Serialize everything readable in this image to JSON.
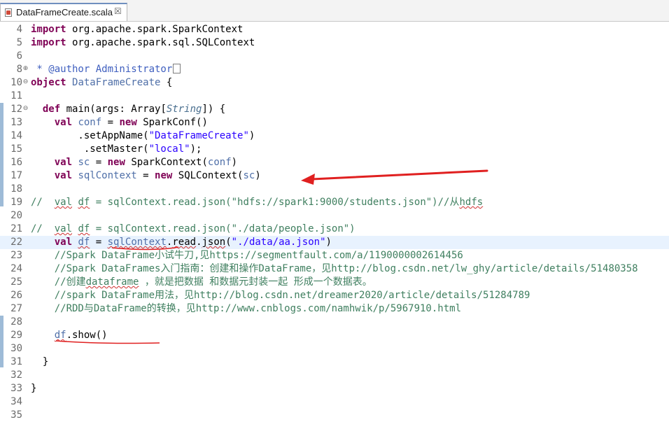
{
  "tab": {
    "title": "DataFrameCreate.scala",
    "close_glyph": "☒"
  },
  "lines": [
    {
      "n": "4",
      "fold": "",
      "parts": [
        [
          "kw",
          "import"
        ],
        [
          "t",
          " org.apache.spark.SparkContext"
        ]
      ]
    },
    {
      "n": "5",
      "fold": "",
      "parts": [
        [
          "kw",
          "import"
        ],
        [
          "t",
          " org.apache.spark.sql.SQLContext"
        ]
      ]
    },
    {
      "n": "6",
      "fold": "",
      "parts": []
    },
    {
      "n": "8",
      "fold": "+",
      "parts": [
        [
          "doc",
          " * @author Administrator"
        ],
        [
          "box",
          ""
        ]
      ]
    },
    {
      "n": "10",
      "fold": "-",
      "parts": [
        [
          "kw",
          "object"
        ],
        [
          "t",
          " "
        ],
        [
          "var",
          "DataFrameCreate"
        ],
        [
          "t",
          " {"
        ]
      ]
    },
    {
      "n": "11",
      "fold": "",
      "parts": []
    },
    {
      "n": "12",
      "fold": "-",
      "parts": [
        [
          "t",
          "  "
        ],
        [
          "kw",
          "def"
        ],
        [
          "t",
          " main(args: Array["
        ],
        [
          "ty",
          "String"
        ],
        [
          "t",
          "]) {"
        ]
      ]
    },
    {
      "n": "13",
      "fold": "",
      "parts": [
        [
          "t",
          "    "
        ],
        [
          "kw",
          "val"
        ],
        [
          "t",
          " "
        ],
        [
          "var",
          "conf"
        ],
        [
          "t",
          " = "
        ],
        [
          "kw",
          "new"
        ],
        [
          "t",
          " SparkConf()"
        ]
      ]
    },
    {
      "n": "14",
      "fold": "",
      "parts": [
        [
          "t",
          "        .setAppName("
        ],
        [
          "str",
          "\"DataFrameCreate\""
        ],
        [
          "t",
          ")"
        ]
      ]
    },
    {
      "n": "15",
      "fold": "",
      "parts": [
        [
          "t",
          "         .setMaster("
        ],
        [
          "str",
          "\"local\""
        ],
        [
          "t",
          ");"
        ]
      ]
    },
    {
      "n": "16",
      "fold": "",
      "parts": [
        [
          "t",
          "    "
        ],
        [
          "kw",
          "val"
        ],
        [
          "t",
          " "
        ],
        [
          "var",
          "sc"
        ],
        [
          "t",
          " = "
        ],
        [
          "kw",
          "new"
        ],
        [
          "t",
          " SparkContext("
        ],
        [
          "var",
          "conf"
        ],
        [
          "t",
          ")"
        ]
      ]
    },
    {
      "n": "17",
      "fold": "",
      "parts": [
        [
          "t",
          "    "
        ],
        [
          "kw",
          "val"
        ],
        [
          "t",
          " "
        ],
        [
          "var",
          "sqlContext"
        ],
        [
          "t",
          " = "
        ],
        [
          "kw",
          "new"
        ],
        [
          "t",
          " SQLContext("
        ],
        [
          "var",
          "sc"
        ],
        [
          "t",
          ")"
        ]
      ]
    },
    {
      "n": "18",
      "fold": "",
      "parts": []
    },
    {
      "n": "19",
      "fold": "",
      "parts": [
        [
          "cm",
          "//  "
        ],
        [
          "cmsq",
          "val"
        ],
        [
          "cm",
          " "
        ],
        [
          "cmsq",
          "df"
        ],
        [
          "cm",
          " = sqlContext.read.json(\"hdfs://spark1:9000/students.json\")//从"
        ],
        [
          "cmsq",
          "hdfs"
        ]
      ]
    },
    {
      "n": "20",
      "fold": "",
      "parts": []
    },
    {
      "n": "21",
      "fold": "",
      "parts": [
        [
          "cm",
          "//  "
        ],
        [
          "cmsq",
          "val"
        ],
        [
          "cm",
          " "
        ],
        [
          "cmsq",
          "df"
        ],
        [
          "cm",
          " = sqlContext.read.json(\"./data/people.json\")"
        ]
      ]
    },
    {
      "n": "22",
      "fold": "",
      "current": true,
      "parts": [
        [
          "t",
          "    "
        ],
        [
          "kw",
          "val"
        ],
        [
          "t",
          " "
        ],
        [
          "varsq",
          "df"
        ],
        [
          "t",
          " = "
        ],
        [
          "varsq",
          "sqlContext"
        ],
        [
          "t",
          "."
        ],
        [
          "sqt",
          "read"
        ],
        [
          "t",
          "."
        ],
        [
          "sqt",
          "json"
        ],
        [
          "t",
          "("
        ],
        [
          "str",
          "\"./data/aa.json\""
        ],
        [
          "t",
          ")"
        ]
      ]
    },
    {
      "n": "23",
      "fold": "",
      "parts": [
        [
          "cm",
          "    //Spark DataFrame小试牛刀,见https://segmentfault.com/a/1190000002614456"
        ]
      ]
    },
    {
      "n": "24",
      "fold": "",
      "parts": [
        [
          "cm",
          "    //Spark DataFrames入门指南：创建和操作DataFrame，见http://blog.csdn.net/lw_ghy/article/details/51480358"
        ]
      ]
    },
    {
      "n": "25",
      "fold": "",
      "parts": [
        [
          "cm",
          "    //创建"
        ],
        [
          "cmsq",
          "dataframe"
        ],
        [
          "cm",
          " ，就是把数据 和数据元封装一起 形成一个数据表。"
        ]
      ]
    },
    {
      "n": "26",
      "fold": "",
      "parts": [
        [
          "cm",
          "    //spark DataFrame用法，见http://blog.csdn.net/dreamer2020/article/details/51284789"
        ]
      ]
    },
    {
      "n": "27",
      "fold": "",
      "parts": [
        [
          "cm",
          "    //RDD与DataFrame的转换，见http://www.cnblogs.com/namhwik/p/5967910.html"
        ]
      ]
    },
    {
      "n": "28",
      "fold": "",
      "parts": []
    },
    {
      "n": "29",
      "fold": "",
      "parts": [
        [
          "t",
          "    "
        ],
        [
          "varsq",
          "df"
        ],
        [
          "t",
          ".show()"
        ]
      ]
    },
    {
      "n": "30",
      "fold": "",
      "parts": []
    },
    {
      "n": "31",
      "fold": "",
      "parts": [
        [
          "t",
          "  }"
        ]
      ]
    },
    {
      "n": "32",
      "fold": "",
      "parts": []
    },
    {
      "n": "33",
      "fold": "",
      "parts": [
        [
          "t",
          "}"
        ]
      ]
    },
    {
      "n": "34",
      "fold": "",
      "parts": []
    },
    {
      "n": "35",
      "fold": "",
      "parts": []
    }
  ],
  "colors": {
    "keyword": "#7f0055",
    "comment": "#3f7f5f",
    "string": "#2a00ff",
    "annotation_red": "#e02020",
    "ruler_blue": "#9ebbd7",
    "current_line": "#e8f2fe"
  }
}
